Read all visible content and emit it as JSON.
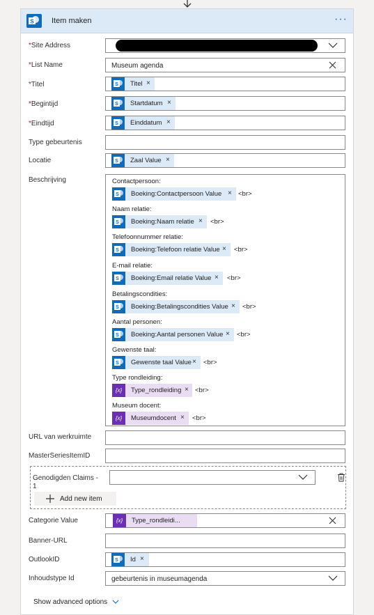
{
  "header": {
    "title": "Item maken",
    "more": "···"
  },
  "fields": {
    "site_address": {
      "label": "Site Address"
    },
    "list_name": {
      "label": "List Name",
      "value": "Museum agenda"
    },
    "titel": {
      "label": "Titel",
      "token": "Titel"
    },
    "begintijd": {
      "label": "Begintijd",
      "token": "Startdatum"
    },
    "eindtijd": {
      "label": "Eindtijd",
      "token": "Einddatum"
    },
    "type_gebeurtenis": {
      "label": "Type gebeurtenis"
    },
    "locatie": {
      "label": "Locatie",
      "token": "Zaal Value"
    },
    "beschrijving": {
      "label": "Beschrijving"
    },
    "url_werkruimte": {
      "label": "URL van werkruimte"
    },
    "master_series": {
      "label": "MasterSeriesItemID"
    },
    "categorie": {
      "label": "Categorie Value",
      "token": "Type_rondleidi..."
    },
    "banner_url": {
      "label": "Banner-URL"
    },
    "outlook_id": {
      "label": "OutlookID",
      "token": "Id"
    },
    "inhoudstype": {
      "label": "Inhoudstype Id",
      "value": "gebeurtenis in museumagenda"
    }
  },
  "required_mark": "*",
  "token_close": "×",
  "description": {
    "lines": [
      "Contactpersoon:",
      "Naam relatie:",
      "Telefoonnummer relatie:",
      "E-mail relatie:",
      "Betalingscondities:",
      "Aantal personen:",
      "Gewenste taal:",
      "Type rondleiding:",
      "Museum docent:"
    ],
    "tokens": [
      "Boeking:Contactpersoon Value",
      "Boeking:Naam relatie",
      "Boeking:Telefoon relatie Value",
      "Boeking:Email relatie Value",
      "Boeking:Betalingscondities Value",
      "Boeking:Aantal personen Value",
      "Gewenste taal Value",
      "Type_rondleiding",
      "Museumdocent"
    ],
    "br": "<br>"
  },
  "claims": {
    "label_line1": "Genodigden Claims -",
    "label_line2": "1",
    "add_label": "Add new item"
  },
  "advanced": "Show advanced options",
  "icons": {
    "sharepoint": "sharepoint-icon",
    "variable": "{x}"
  },
  "colors": {
    "accent": "#0f6cbd",
    "header_bg": "#dce9f7",
    "token_bg": "#dce9f7",
    "var_token_bg": "#e9ddf3",
    "var_icon": "#6b2fb3",
    "required": "#a4262c"
  }
}
